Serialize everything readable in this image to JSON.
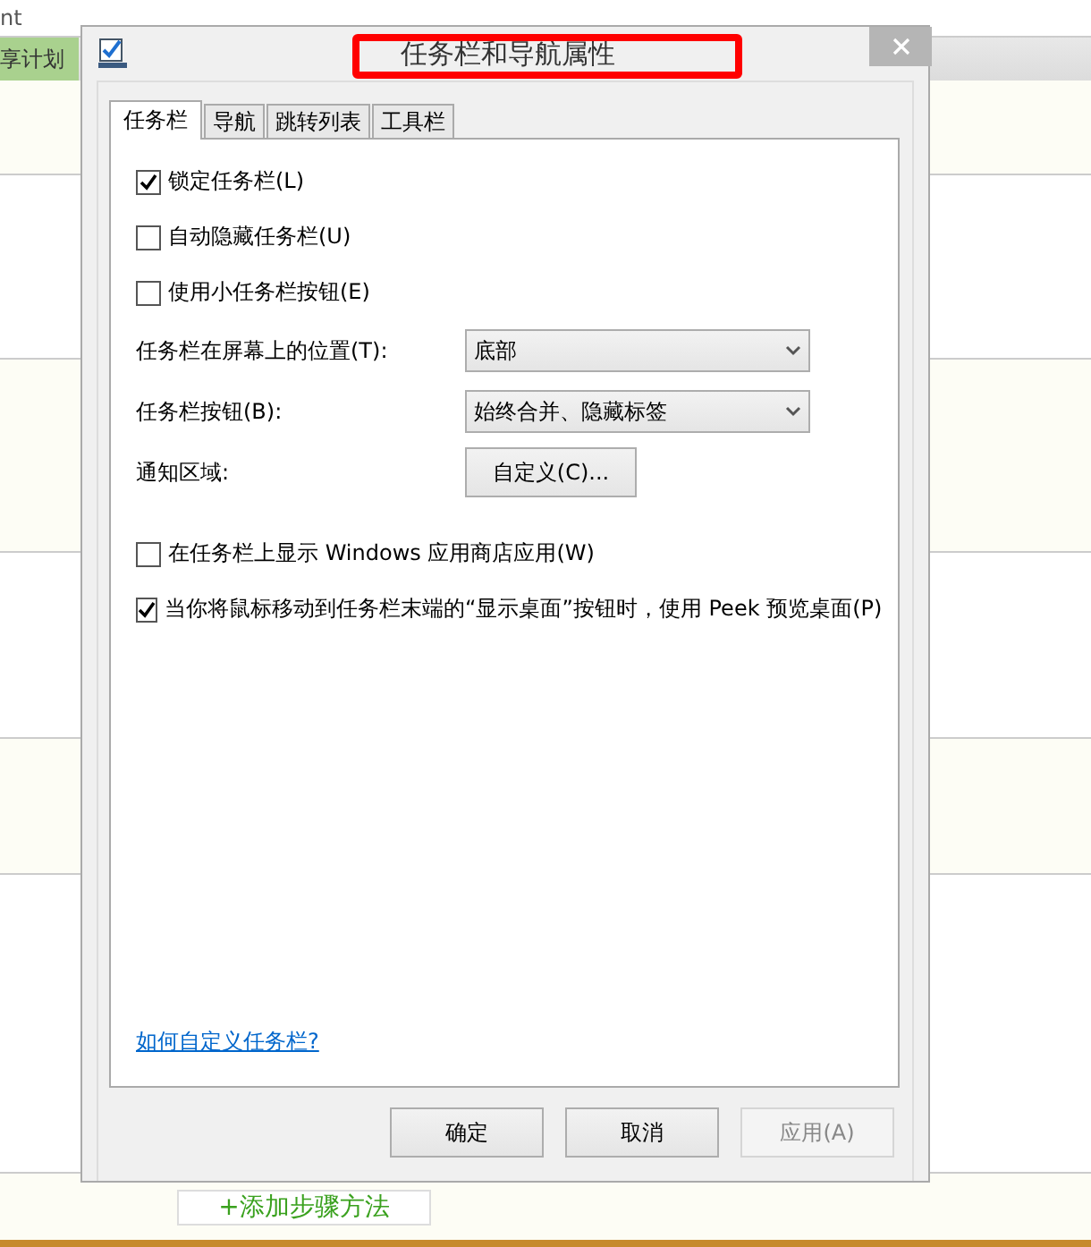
{
  "background": {
    "header_text": "nt",
    "tab_label": "享计划",
    "add_button": "+添加步骤方法"
  },
  "window": {
    "title": "任务栏和导航属性",
    "title_highlight": true
  },
  "tabs": [
    {
      "label": "任务栏",
      "selected": true
    },
    {
      "label": "导航",
      "selected": false
    },
    {
      "label": "跳转列表",
      "selected": false
    },
    {
      "label": "工具栏",
      "selected": false
    }
  ],
  "options": [
    {
      "kind": "checkbox",
      "label": "锁定任务栏(L)",
      "checked": true
    },
    {
      "kind": "checkbox",
      "label": "自动隐藏任务栏(U)",
      "checked": false
    },
    {
      "kind": "checkbox",
      "label": "使用小任务栏按钮(E)",
      "checked": false
    },
    {
      "kind": "dropdown",
      "label": "任务栏在屏幕上的位置(T):",
      "value": "底部"
    },
    {
      "kind": "dropdown",
      "label": "任务栏按钮(B):",
      "value": "始终合并、隐藏标签"
    },
    {
      "kind": "button",
      "label": "通知区域:",
      "button": "自定义(C)..."
    },
    {
      "kind": "checkbox",
      "label": "在任务栏上显示 Windows 应用商店应用(W)",
      "checked": false
    },
    {
      "kind": "checkbox",
      "label": "当你将鼠标移动到任务栏末端的“显示桌面”按钮时，使用 Peek 预览桌面(P)",
      "checked": true
    }
  ],
  "help_link": "如何自定义任务栏?",
  "buttons": [
    {
      "label": "确定",
      "disabled": false
    },
    {
      "label": "取消",
      "disabled": false
    },
    {
      "label": "应用(A)",
      "disabled": true
    }
  ]
}
